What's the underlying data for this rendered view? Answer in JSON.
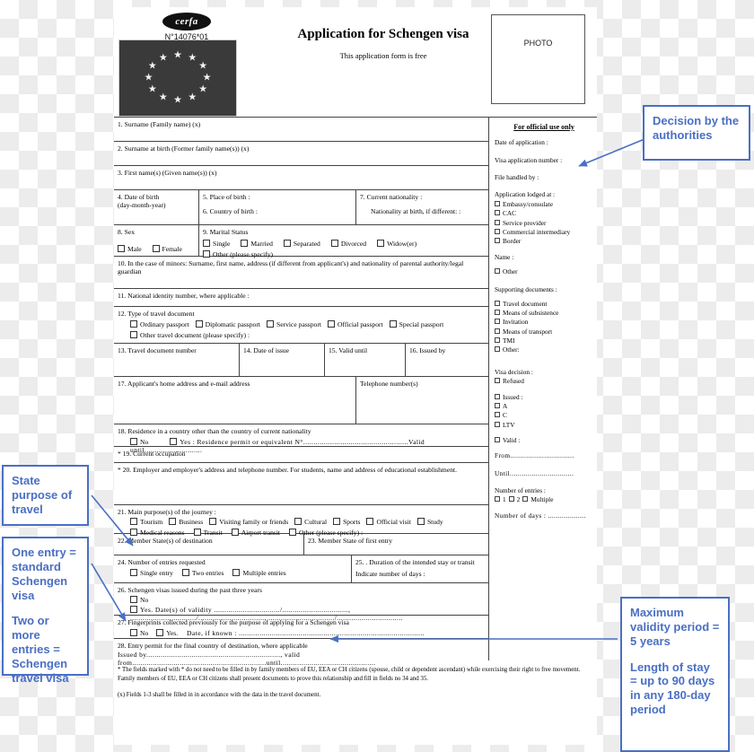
{
  "header": {
    "cerfa_logo": "cerfa",
    "cerfa_number": "N°14076*01",
    "title": "Application for Schengen visa",
    "subtitle": "This application form is free",
    "photo_label": "PHOTO"
  },
  "fields": {
    "f1": "1. Surname (Family name) (x)",
    "f2": "2. Surname at birth (Former family name(s)) (x)",
    "f3": "3. First name(s) (Given name(s)) (x)",
    "f4": "4.  Date of birth",
    "f4b": "(day-month-year)",
    "f5": "5.  Place of birth :",
    "f6": "6.  Country of birth :",
    "f7": "7.  Current nationality :",
    "f7b": "Nationality at birth, if different: :",
    "f8": "8. Sex",
    "f8_male": "Male",
    "f8_female": "Female",
    "f9": "9. Marital Status",
    "f9_opts": [
      "Single",
      "Married",
      "Separated",
      "Divorced",
      "Widow(er)"
    ],
    "f9_other": "Other (please specify)",
    "f10": "10. In the case of minors: Surname, first name, address (if different from applicant's) and nationality of parental authority/legal guardian",
    "f11": "11. National identity number, where applicable :",
    "f12": "12. Type of travel document",
    "f12_opts": [
      "Ordinary passport",
      "Diplomatic passport",
      "Service passport",
      "Official passport",
      "Special passport"
    ],
    "f12_other": "Other travel document (please specify) :",
    "f13": "13.  Travel document number",
    "f14": "14. Date of issue",
    "f15": "15. Valid until",
    "f16": "16. Issued by",
    "f17": "17. Applicant's home address and e-mail address",
    "f17b": "Telephone number(s)",
    "f18": "18.  Residence in a country other than the country of current nationality",
    "f18_no": "No",
    "f18_yes": "Yes :  Residence permit or equivalent N°...................................................Valid until............................",
    "f19": "*  19.  Current occupation",
    "f20": "*  20.  Employer and employer's address and telephone number. For students, name and address of educational establishment.",
    "f21": "21.  Main purpose(s) of the journey :",
    "f21_opts1": [
      "Tourism",
      "Business",
      "Visiting family or friends",
      "Cultural",
      "Sports",
      "Official visit",
      "Study"
    ],
    "f21_opts2": [
      "Medical reasons",
      "Transit",
      "Airport transit",
      "Other (please specify) :"
    ],
    "f22": "22.  Member State(s) of destination",
    "f23": "23.  Member State of first entry",
    "f24": "24.  Number of entries requested",
    "f24_opts": [
      "Single entry",
      "Two entries",
      "Multiple entries"
    ],
    "f25": "25. . Duration of the intended stay or transit",
    "f25b": "Indicate number of days :",
    "f26": "26.  Schengen visas issued during the past three years",
    "f26_no": "No",
    "f26_yes": "Yes. Date(s) of validity ................................/................................, ................................/................................, ................................/................................",
    "f27": "27.  Fingerprints collected previously for the purpose of applying for a Schengen visa",
    "f27_no": "No",
    "f27_yes": "Yes.",
    "f27_date": "Date, if known : ..........................................................................................",
    "f28": "28.  Entry permit for the final country of destination, where applicable",
    "f28b": "Issued by................................................................., valid from.................................................................until.............................................."
  },
  "official": {
    "heading": "For official use only",
    "date_of_application": "Date of application :",
    "visa_application_number": "Visa application number :",
    "file_handled_by": "File handled by :",
    "lodged_at_label": "Application lodged at :",
    "lodged_at_opts": [
      "Embassy/consulate",
      "CAC",
      "Service provider",
      "Commercial intermediary",
      "Border"
    ],
    "name_label": "Name :",
    "name_other": "Other",
    "supporting_label": "Supporting documents :",
    "supporting_opts": [
      "Travel document",
      "Means of subsistence",
      "Invitation",
      "Means of transport",
      "TMI",
      "Other:"
    ],
    "visa_decision_label": "Visa decision :",
    "refused": "Refused",
    "issued": "Issued :",
    "issued_types": [
      "A",
      "C",
      "LTV"
    ],
    "valid": "Valid :",
    "from": "From................................",
    "until": "Until................................",
    "entries_label": "Number of entries :",
    "entries_opts": [
      "1",
      "2",
      "Multiple"
    ],
    "days_label": "Number of days : ..................."
  },
  "notes": {
    "note1": "* The fields marked with * do not need to be filled in by family members of EU, EEA or CH citizens (spouse, child or dependent ascendant) while exercising their right to free movement. Family members of EU, EEA or CH citizens shall present documents to prove this relationship and fill in fields no 34 and 35.",
    "note2": "(x) Fields 1-3 shall be filled in in accordance with the data in the travel document."
  },
  "annotations": {
    "decision": "Decision by the authorities",
    "purpose": "State purpose of travel",
    "entries_one": "One entry = standard Schengen visa",
    "entries_two": "Two or more entries = Schengen travel visa",
    "validity": "Maximum validity period = 5 years",
    "length": "Length of stay = up to 90 days in any 180-day period"
  },
  "colors": {
    "annotation_blue": "#4a6fc4",
    "flag_background": "#3a3a3a"
  }
}
